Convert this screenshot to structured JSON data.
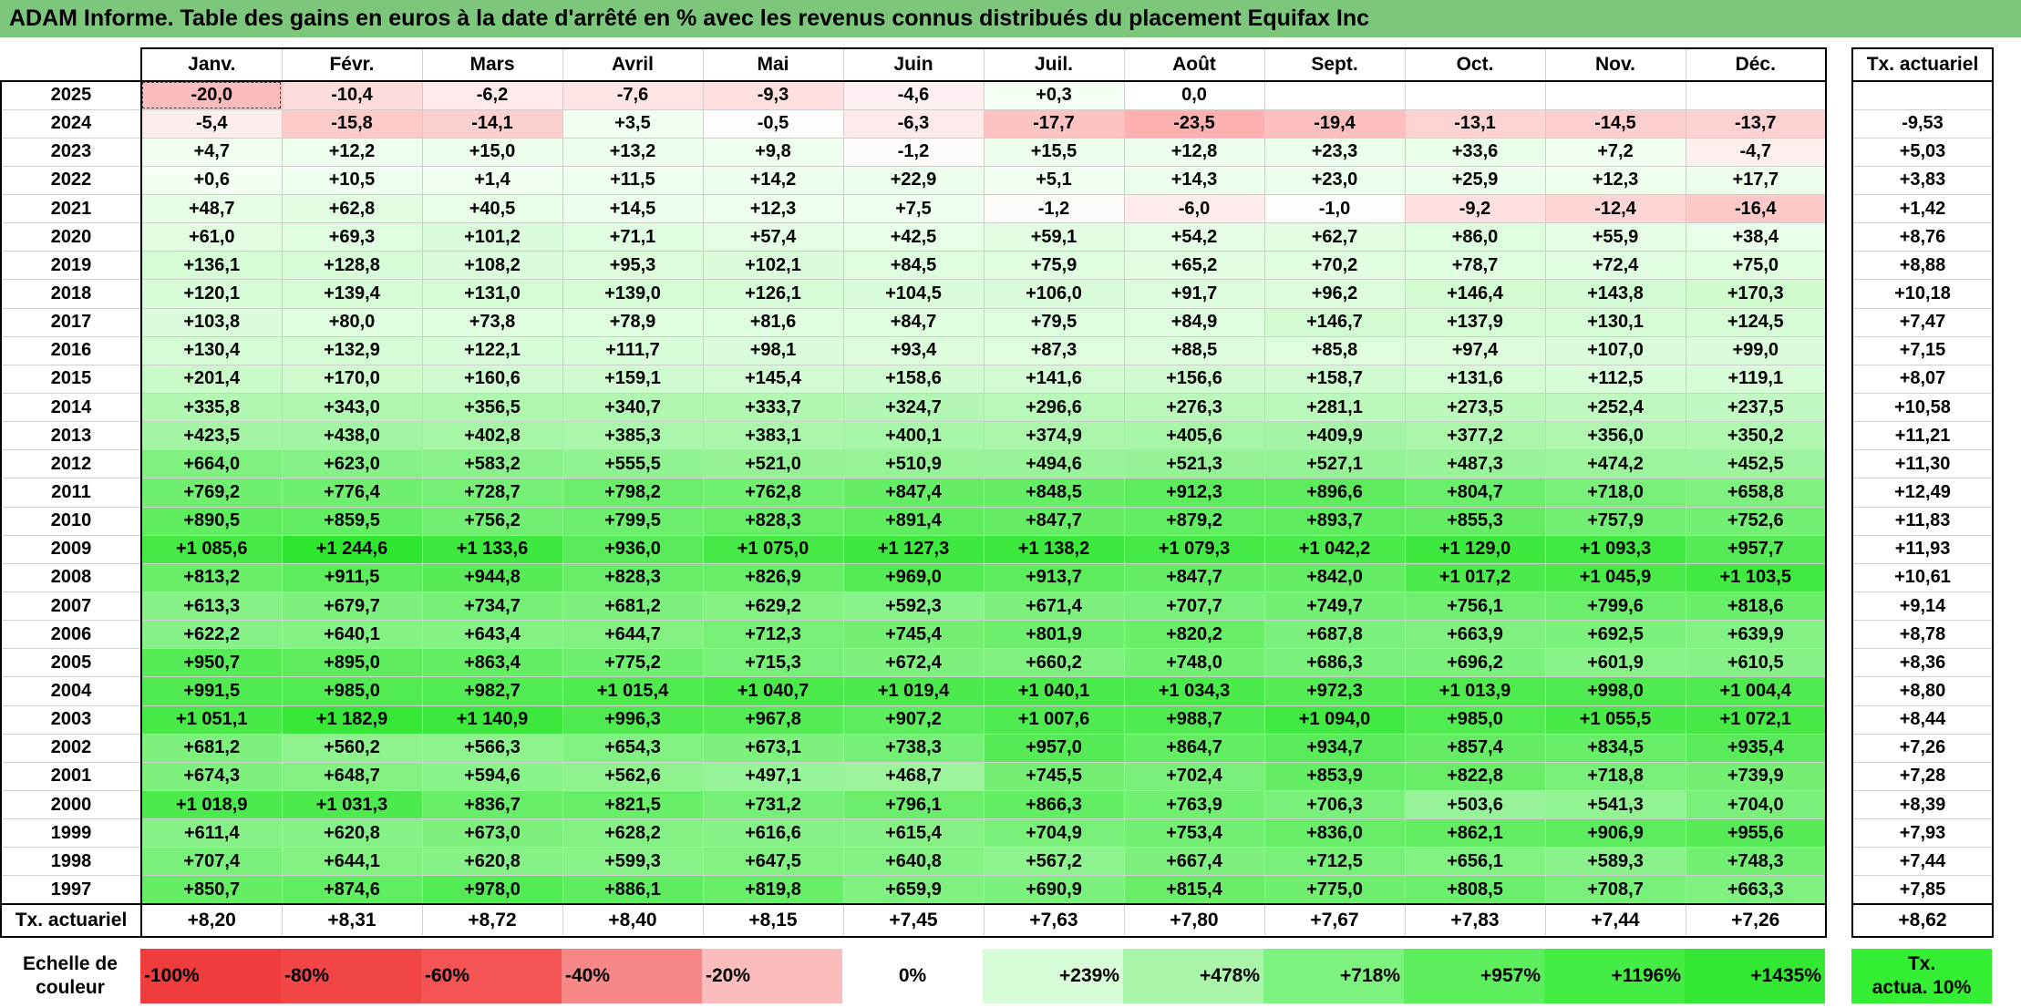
{
  "title": "ADAM Informe. Table des gains en euros à la date d'arrêté en % avec les revenus connus distribués du placement Equifax Inc",
  "months": [
    "Janv.",
    "Févr.",
    "Mars",
    "Avril",
    "Mai",
    "Juin",
    "Juil.",
    "Août",
    "Sept.",
    "Oct.",
    "Nov.",
    "Déc."
  ],
  "tx_header": "Tx. actuariel",
  "rows": [
    {
      "year": "2025",
      "values": [
        "-20,0",
        "-10,4",
        "-6,2",
        "-7,6",
        "-9,3",
        "-4,6",
        "+0,3",
        "0,0",
        "",
        "",
        "",
        ""
      ],
      "tx": ""
    },
    {
      "year": "2024",
      "values": [
        "-5,4",
        "-15,8",
        "-14,1",
        "+3,5",
        "-0,5",
        "-6,3",
        "-17,7",
        "-23,5",
        "-19,4",
        "-13,1",
        "-14,5",
        "-13,7"
      ],
      "tx": "-9,53"
    },
    {
      "year": "2023",
      "values": [
        "+4,7",
        "+12,2",
        "+15,0",
        "+13,2",
        "+9,8",
        "-1,2",
        "+15,5",
        "+12,8",
        "+23,3",
        "+33,6",
        "+7,2",
        "-4,7"
      ],
      "tx": "+5,03"
    },
    {
      "year": "2022",
      "values": [
        "+0,6",
        "+10,5",
        "+1,4",
        "+11,5",
        "+14,2",
        "+22,9",
        "+5,1",
        "+14,3",
        "+23,0",
        "+25,9",
        "+12,3",
        "+17,7"
      ],
      "tx": "+3,83"
    },
    {
      "year": "2021",
      "values": [
        "+48,7",
        "+62,8",
        "+40,5",
        "+14,5",
        "+12,3",
        "+7,5",
        "-1,2",
        "-6,0",
        "-1,0",
        "-9,2",
        "-12,4",
        "-16,4"
      ],
      "tx": "+1,42"
    },
    {
      "year": "2020",
      "values": [
        "+61,0",
        "+69,3",
        "+101,2",
        "+71,1",
        "+57,4",
        "+42,5",
        "+59,1",
        "+54,2",
        "+62,7",
        "+86,0",
        "+55,9",
        "+38,4"
      ],
      "tx": "+8,76"
    },
    {
      "year": "2019",
      "values": [
        "+136,1",
        "+128,8",
        "+108,2",
        "+95,3",
        "+102,1",
        "+84,5",
        "+75,9",
        "+65,2",
        "+70,2",
        "+78,7",
        "+72,4",
        "+75,0"
      ],
      "tx": "+8,88"
    },
    {
      "year": "2018",
      "values": [
        "+120,1",
        "+139,4",
        "+131,0",
        "+139,0",
        "+126,1",
        "+104,5",
        "+106,0",
        "+91,7",
        "+96,2",
        "+146,4",
        "+143,8",
        "+170,3"
      ],
      "tx": "+10,18"
    },
    {
      "year": "2017",
      "values": [
        "+103,8",
        "+80,0",
        "+73,8",
        "+78,9",
        "+81,6",
        "+84,7",
        "+79,5",
        "+84,9",
        "+146,7",
        "+137,9",
        "+130,1",
        "+124,5"
      ],
      "tx": "+7,47"
    },
    {
      "year": "2016",
      "values": [
        "+130,4",
        "+132,9",
        "+122,1",
        "+111,7",
        "+98,1",
        "+93,4",
        "+87,3",
        "+88,5",
        "+85,8",
        "+97,4",
        "+107,0",
        "+99,0"
      ],
      "tx": "+7,15"
    },
    {
      "year": "2015",
      "values": [
        "+201,4",
        "+170,0",
        "+160,6",
        "+159,1",
        "+145,4",
        "+158,6",
        "+141,6",
        "+156,6",
        "+158,7",
        "+131,6",
        "+112,5",
        "+119,1"
      ],
      "tx": "+8,07"
    },
    {
      "year": "2014",
      "values": [
        "+335,8",
        "+343,0",
        "+356,5",
        "+340,7",
        "+333,7",
        "+324,7",
        "+296,6",
        "+276,3",
        "+281,1",
        "+273,5",
        "+252,4",
        "+237,5"
      ],
      "tx": "+10,58"
    },
    {
      "year": "2013",
      "values": [
        "+423,5",
        "+438,0",
        "+402,8",
        "+385,3",
        "+383,1",
        "+400,1",
        "+374,9",
        "+405,6",
        "+409,9",
        "+377,2",
        "+356,0",
        "+350,2"
      ],
      "tx": "+11,21"
    },
    {
      "year": "2012",
      "values": [
        "+664,0",
        "+623,0",
        "+583,2",
        "+555,5",
        "+521,0",
        "+510,9",
        "+494,6",
        "+521,3",
        "+527,1",
        "+487,3",
        "+474,2",
        "+452,5"
      ],
      "tx": "+11,30"
    },
    {
      "year": "2011",
      "values": [
        "+769,2",
        "+776,4",
        "+728,7",
        "+798,2",
        "+762,8",
        "+847,4",
        "+848,5",
        "+912,3",
        "+896,6",
        "+804,7",
        "+718,0",
        "+658,8"
      ],
      "tx": "+12,49"
    },
    {
      "year": "2010",
      "values": [
        "+890,5",
        "+859,5",
        "+756,2",
        "+799,5",
        "+828,3",
        "+891,4",
        "+847,7",
        "+879,2",
        "+893,7",
        "+855,3",
        "+757,9",
        "+752,6"
      ],
      "tx": "+11,83"
    },
    {
      "year": "2009",
      "values": [
        "+1 085,6",
        "+1 244,6",
        "+1 133,6",
        "+936,0",
        "+1 075,0",
        "+1 127,3",
        "+1 138,2",
        "+1 079,3",
        "+1 042,2",
        "+1 129,0",
        "+1 093,3",
        "+957,7"
      ],
      "tx": "+11,93"
    },
    {
      "year": "2008",
      "values": [
        "+813,2",
        "+911,5",
        "+944,8",
        "+828,3",
        "+826,9",
        "+969,0",
        "+913,7",
        "+847,7",
        "+842,0",
        "+1 017,2",
        "+1 045,9",
        "+1 103,5"
      ],
      "tx": "+10,61"
    },
    {
      "year": "2007",
      "values": [
        "+613,3",
        "+679,7",
        "+734,7",
        "+681,2",
        "+629,2",
        "+592,3",
        "+671,4",
        "+707,7",
        "+749,7",
        "+756,1",
        "+799,6",
        "+818,6"
      ],
      "tx": "+9,14"
    },
    {
      "year": "2006",
      "values": [
        "+622,2",
        "+640,1",
        "+643,4",
        "+644,7",
        "+712,3",
        "+745,4",
        "+801,9",
        "+820,2",
        "+687,8",
        "+663,9",
        "+692,5",
        "+639,9"
      ],
      "tx": "+8,78"
    },
    {
      "year": "2005",
      "values": [
        "+950,7",
        "+895,0",
        "+863,4",
        "+775,2",
        "+715,3",
        "+672,4",
        "+660,2",
        "+748,0",
        "+686,3",
        "+696,2",
        "+601,9",
        "+610,5"
      ],
      "tx": "+8,36"
    },
    {
      "year": "2004",
      "values": [
        "+991,5",
        "+985,0",
        "+982,7",
        "+1 015,4",
        "+1 040,7",
        "+1 019,4",
        "+1 040,1",
        "+1 034,3",
        "+972,3",
        "+1 013,9",
        "+998,0",
        "+1 004,4"
      ],
      "tx": "+8,80"
    },
    {
      "year": "2003",
      "values": [
        "+1 051,1",
        "+1 182,9",
        "+1 140,9",
        "+996,3",
        "+967,8",
        "+907,2",
        "+1 007,6",
        "+988,7",
        "+1 094,0",
        "+985,0",
        "+1 055,5",
        "+1 072,1"
      ],
      "tx": "+8,44"
    },
    {
      "year": "2002",
      "values": [
        "+681,2",
        "+560,2",
        "+566,3",
        "+654,3",
        "+673,1",
        "+738,3",
        "+957,0",
        "+864,7",
        "+934,7",
        "+857,4",
        "+834,5",
        "+935,4"
      ],
      "tx": "+7,26"
    },
    {
      "year": "2001",
      "values": [
        "+674,3",
        "+648,7",
        "+594,6",
        "+562,6",
        "+497,1",
        "+468,7",
        "+745,5",
        "+702,4",
        "+853,9",
        "+822,8",
        "+718,8",
        "+739,9"
      ],
      "tx": "+7,28"
    },
    {
      "year": "2000",
      "values": [
        "+1 018,9",
        "+1 031,3",
        "+836,7",
        "+821,5",
        "+731,2",
        "+796,1",
        "+866,3",
        "+763,9",
        "+706,3",
        "+503,6",
        "+541,3",
        "+704,0"
      ],
      "tx": "+8,39"
    },
    {
      "year": "1999",
      "values": [
        "+611,4",
        "+620,8",
        "+673,0",
        "+628,2",
        "+616,6",
        "+615,4",
        "+704,9",
        "+753,4",
        "+836,0",
        "+862,1",
        "+906,9",
        "+955,6"
      ],
      "tx": "+7,93"
    },
    {
      "year": "1998",
      "values": [
        "+707,4",
        "+644,1",
        "+620,8",
        "+599,3",
        "+647,5",
        "+640,8",
        "+567,2",
        "+667,4",
        "+712,5",
        "+656,1",
        "+589,3",
        "+748,3"
      ],
      "tx": "+7,44"
    },
    {
      "year": "1997",
      "values": [
        "+850,7",
        "+874,6",
        "+978,0",
        "+886,1",
        "+819,8",
        "+659,9",
        "+690,9",
        "+815,4",
        "+775,0",
        "+808,5",
        "+708,7",
        "+663,3"
      ],
      "tx": "+7,85"
    }
  ],
  "total_row": {
    "label": "Tx. actuariel",
    "values": [
      "+8,20",
      "+8,31",
      "+8,72",
      "+8,40",
      "+8,15",
      "+7,45",
      "+7,63",
      "+7,80",
      "+7,67",
      "+7,83",
      "+7,44",
      "+7,26"
    ],
    "tx": "+8,62"
  },
  "legend": {
    "label_line1": "Echelle de",
    "label_line2": "couleur",
    "items": [
      {
        "text": "-100%",
        "color": "#f03c3c",
        "kind": "neg"
      },
      {
        "text": "-80%",
        "color": "#f24646",
        "kind": "neg"
      },
      {
        "text": "-60%",
        "color": "#f55454",
        "kind": "neg"
      },
      {
        "text": "-40%",
        "color": "#f88888",
        "kind": "neg"
      },
      {
        "text": "-20%",
        "color": "#fbbcbc",
        "kind": "neg"
      },
      {
        "text": "0%",
        "color": "#ffffff",
        "kind": "zero"
      },
      {
        "text": "+239%",
        "color": "#d8fbd8",
        "kind": "pos"
      },
      {
        "text": "+478%",
        "color": "#aaf5aa",
        "kind": "pos"
      },
      {
        "text": "+718%",
        "color": "#7ef27e",
        "kind": "pos"
      },
      {
        "text": "+957%",
        "color": "#5cee5c",
        "kind": "pos"
      },
      {
        "text": "+1196%",
        "color": "#44ec44",
        "kind": "pos"
      },
      {
        "text": "+1435%",
        "color": "#33e833",
        "kind": "pos"
      }
    ],
    "tx_line1": "Tx.",
    "tx_line2": "actua. 10%",
    "tx_color": "#33ee33"
  },
  "colors": {
    "title_bg": "#7dc77d",
    "neg_max": "#f03c3c",
    "pos_max": "#2ee62e"
  }
}
